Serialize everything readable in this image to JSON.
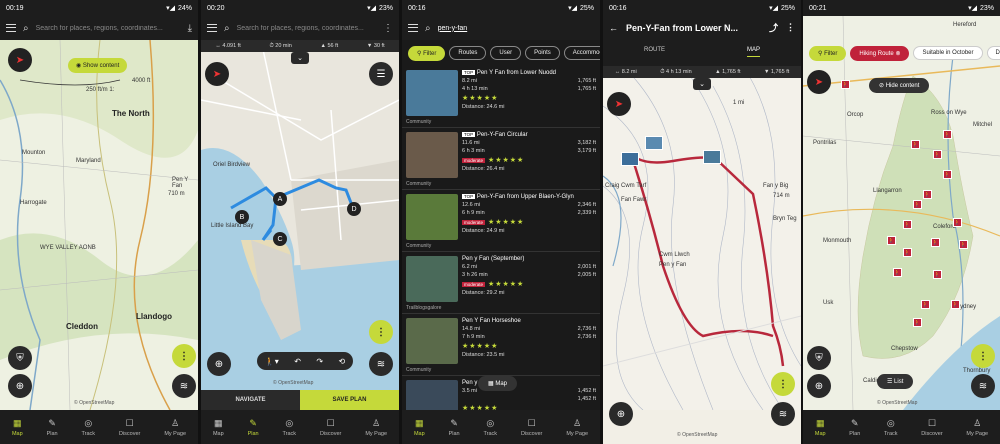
{
  "screens": [
    {
      "status": {
        "time": "00:19",
        "battery": "24%"
      },
      "search_placeholder": "Search for places, regions, coordinates...",
      "show_content": "Show content",
      "scale": "4000 ft",
      "scale2": "250 ft/m 1:",
      "map_labels": [
        "The North",
        "Pen Y Fan",
        "710 m",
        "WYE VALLEY AONB",
        "Cleddon",
        "Llandogo",
        "Maryland",
        "Harrogate",
        "Mounton"
      ],
      "osm": "© OpenStreetMap",
      "nav": [
        "Map",
        "Plan",
        "Track",
        "Discover",
        "My Page"
      ],
      "nav_active": 0
    },
    {
      "status": {
        "time": "00:20",
        "battery": "23%"
      },
      "search_placeholder": "Search for places, regions, coordinates...",
      "stats": [
        "↔ 4.091 ft",
        "⏱ 20 min",
        "▲ 56 ft",
        "▼ 30 ft"
      ],
      "waypoints": [
        "A",
        "B",
        "C",
        "D"
      ],
      "map_labels": [
        "Little Island Bay",
        "Oriel Birdview"
      ],
      "osm": "© OpenStreetMap",
      "navigate": "NAVIGATE",
      "save_plan": "SAVE PLAN",
      "nav": [
        "Map",
        "Plan",
        "Track",
        "Discover",
        "My Page"
      ],
      "nav_active": 1
    },
    {
      "status": {
        "time": "00:16",
        "battery": "25%"
      },
      "query": "pen-y-fan",
      "filters": [
        "Filter",
        "Routes",
        "User",
        "Points",
        "Accommodation"
      ],
      "results": [
        {
          "title": "Pen Y Fan from Lower Nuodd",
          "top": "TOP",
          "badge": "",
          "dist": "8.2 mi",
          "time": "4 h 13 min",
          "up": "1,765 ft",
          "down": "1,765 ft",
          "distance": "Distance: 24.6 mi",
          "source": "Community",
          "color": "#4a7a9a"
        },
        {
          "title": "Pen-Y-Fan Circular",
          "top": "TOP",
          "badge": "moderate",
          "dist": "11.6 mi",
          "time": "6 h 3 min",
          "up": "3,182 ft",
          "down": "3,179 ft",
          "distance": "Distance: 26.4 mi",
          "source": "Community",
          "color": "#6a5a4a"
        },
        {
          "title": "Pen-Y-Fan from Upper Blaen-Y-Glyn",
          "top": "TOP",
          "badge": "moderate",
          "dist": "12.6 mi",
          "time": "6 h 9 min",
          "up": "2,346 ft",
          "down": "2,339 ft",
          "distance": "Distance: 24.9 mi",
          "source": "Community",
          "color": "#5a7a3a"
        },
        {
          "title": "Pen y Fan (September)",
          "top": "",
          "badge": "moderate",
          "dist": "6.2 mi",
          "time": "3 h 26 min",
          "up": "2,001 ft",
          "down": "2,005 ft",
          "distance": "Distance: 29.2 mi",
          "source": "Trailblogsgalore",
          "color": "#4a6a5a"
        },
        {
          "title": "Pen Y Fan Horseshoe",
          "top": "",
          "badge": "",
          "dist": "14.8 mi",
          "time": "7 h 9 min",
          "up": "2,736 ft",
          "down": "2,736 ft",
          "distance": "Distance: 23.5 mi",
          "source": "Community",
          "color": "#5a6a4a"
        },
        {
          "title": "Pen y Fan",
          "top": "",
          "badge": "",
          "dist": "3.5 mi",
          "time": "",
          "up": "1,452 ft",
          "down": "1,452 ft",
          "distance": "",
          "source": "",
          "color": "#3a4a5a"
        }
      ],
      "map_button": "Map",
      "nav": [
        "Map",
        "Plan",
        "Track",
        "Discover",
        "My Page"
      ],
      "nav_active": 0
    },
    {
      "status": {
        "time": "00:16",
        "battery": "25%"
      },
      "title": "Pen-Y-Fan from Lower N...",
      "tabs": [
        "ROUTE",
        "MAP"
      ],
      "active_tab": 1,
      "stats": [
        "↔ 8.2 mi",
        "⏱ 4 h 13 min",
        "▲ 1,765 ft",
        "▼ 1,765 ft"
      ],
      "map_labels": [
        "Craig Cwm Tarf",
        "Fan Fawr",
        "Cwm Llwch",
        "Pen y Fan",
        "Fan y Big",
        "714 m",
        "1 mi",
        "Bryn Teg"
      ],
      "osm": "© OpenStreetMap",
      "nav": [
        "Map",
        "Plan",
        "Track",
        "Discover",
        "My Page"
      ],
      "nav_active": 0
    },
    {
      "status": {
        "time": "00:21",
        "battery": "23%"
      },
      "filters": [
        "Filter",
        "Hiking Route",
        "Suitable in October",
        "Dif"
      ],
      "hide_content": "Hide content",
      "map_labels": [
        "Hereford",
        "Ross on Wye",
        "Mitchel",
        "Orcop",
        "Llangarron",
        "Coleford",
        "Lydney",
        "Monmouth",
        "Usk",
        "Chepstow",
        "Caldicot",
        "Thornbury",
        "Pontrilas"
      ],
      "list_button": "List",
      "osm": "© OpenStreetMap",
      "nav": [
        "Map",
        "Plan",
        "Track",
        "Discover",
        "My Page"
      ],
      "nav_active": 0
    }
  ],
  "nav_icons": [
    "▦",
    "✎",
    "◎",
    "☐",
    "♙"
  ]
}
